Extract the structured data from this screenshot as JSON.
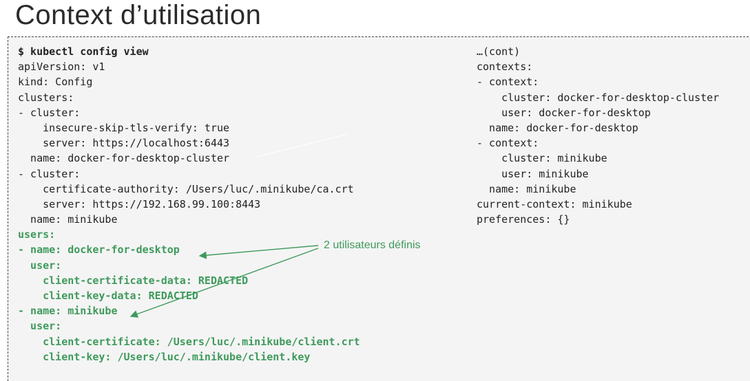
{
  "title": "Context d’utilisation",
  "annotation": "2 utilisateurs définis",
  "left_lines": [
    {
      "text": "$ kubectl config view",
      "style": "bold"
    },
    {
      "text": "apiVersion: v1",
      "style": ""
    },
    {
      "text": "kind: Config",
      "style": ""
    },
    {
      "text": "clusters:",
      "style": ""
    },
    {
      "text": "- cluster:",
      "style": ""
    },
    {
      "text": "    insecure-skip-tls-verify: true",
      "style": ""
    },
    {
      "text": "    server: https://localhost:6443",
      "style": ""
    },
    {
      "text": "  name: docker-for-desktop-cluster",
      "style": ""
    },
    {
      "text": "- cluster:",
      "style": ""
    },
    {
      "text": "    certificate-authority: /Users/luc/.minikube/ca.crt",
      "style": ""
    },
    {
      "text": "    server: https://192.168.99.100:8443",
      "style": ""
    },
    {
      "text": "  name: minikube",
      "style": ""
    },
    {
      "text": "users:",
      "style": "green"
    },
    {
      "text": "- name: docker-for-desktop",
      "style": "green"
    },
    {
      "text": "  user:",
      "style": "green"
    },
    {
      "text": "    client-certificate-data: REDACTED",
      "style": "green"
    },
    {
      "text": "    client-key-data: REDACTED",
      "style": "green"
    },
    {
      "text": "- name: minikube",
      "style": "green"
    },
    {
      "text": "  user:",
      "style": "green"
    },
    {
      "text": "    client-certificate: /Users/luc/.minikube/client.crt",
      "style": "green"
    },
    {
      "text": "    client-key: /Users/luc/.minikube/client.key",
      "style": "green"
    }
  ],
  "right_lines": [
    {
      "text": "…(cont)",
      "style": ""
    },
    {
      "text": "contexts:",
      "style": ""
    },
    {
      "text": "- context:",
      "style": ""
    },
    {
      "text": "    cluster: docker-for-desktop-cluster",
      "style": ""
    },
    {
      "text": "    user: docker-for-desktop",
      "style": ""
    },
    {
      "text": "  name: docker-for-desktop",
      "style": ""
    },
    {
      "text": "- context:",
      "style": ""
    },
    {
      "text": "    cluster: minikube",
      "style": ""
    },
    {
      "text": "    user: minikube",
      "style": ""
    },
    {
      "text": "  name: minikube",
      "style": ""
    },
    {
      "text": "current-context: minikube",
      "style": ""
    },
    {
      "text": "preferences: {}",
      "style": ""
    }
  ],
  "colors": {
    "accent_green": "#3f9a5c",
    "panel_bg": "#f4f4f4",
    "text": "#222222"
  }
}
